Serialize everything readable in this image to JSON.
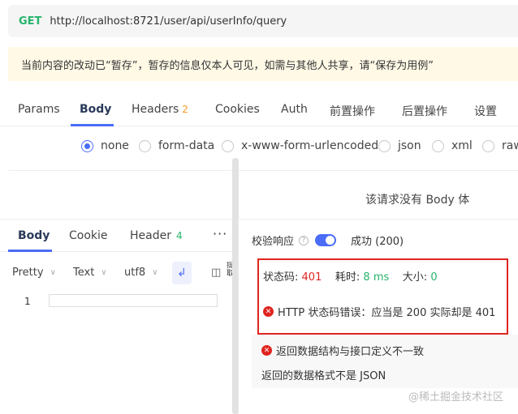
{
  "request": {
    "method": "GET",
    "url": "http://localhost:8721/user/api/userInfo/query"
  },
  "notice": "当前内容的改动已“暂存”，暂存的信息仅本人可见，如需与其他人共享，请“保存为用例”",
  "tabs": {
    "params": "Params",
    "body": "Body",
    "headers": "Headers",
    "headers_count": "2",
    "cookies": "Cookies",
    "auth": "Auth",
    "pre_ops": "前置操作",
    "post_ops": "后置操作",
    "settings": "设置"
  },
  "body_types": [
    "none",
    "form-data",
    "x-www-form-urlencoded",
    "json",
    "xml",
    "raw"
  ],
  "body_selected": "none",
  "no_body_text": "该请求没有 Body 体",
  "response": {
    "tabs": {
      "body": "Body",
      "cookie": "Cookie",
      "header": "Header",
      "header_count": "4",
      "more": "···"
    },
    "format": {
      "pretty": "Pretty",
      "text": "Text",
      "charset": "utf8",
      "extra": "提取"
    },
    "line_number": "1"
  },
  "validation": {
    "label": "校验响应",
    "status_text": "成功 (200)",
    "status_code_label": "状态码:",
    "status_code": "401",
    "time_label": "耗时:",
    "time": "8 ms",
    "size_label": "大小:",
    "size": "0",
    "http_error": "HTTP 状态码错误：应当是 200 实际却是 401",
    "schema_error": "返回数据结构与接口定义不一致",
    "schema_detail": "返回的数据格式不是 JSON"
  },
  "watermark": "@稀土掘金技术社区",
  "colors": {
    "accent": "#4a6cf7",
    "success": "#26b36b",
    "error": "#e0241f",
    "warning": "#f59a23"
  }
}
